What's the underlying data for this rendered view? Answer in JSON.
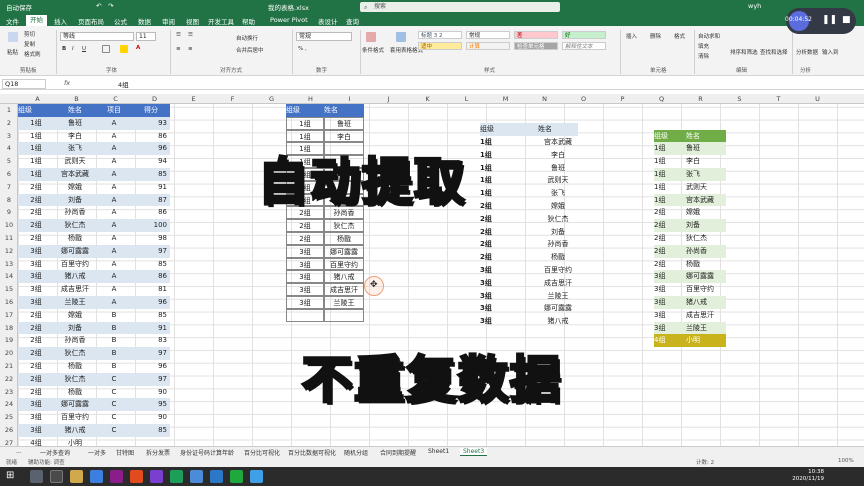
{
  "window": {
    "autosave": "自动保存",
    "filename": "我的表格.xlsx",
    "user": "wyh",
    "search_placeholder": "搜索"
  },
  "menu": [
    "文件",
    "开始",
    "插入",
    "页面布局",
    "公式",
    "数据",
    "审阅",
    "视图",
    "开发工具",
    "帮助",
    "Power Pivot",
    "表设计",
    "查询"
  ],
  "ribbon": {
    "paste": "粘贴",
    "cut": "剪切",
    "copy": "复制",
    "format_painter": "格式刷",
    "font_name": "等线",
    "font_size": "11",
    "wrap": "自动换行",
    "merge": "合并后居中",
    "num_format": "常规",
    "cond_format": "条件格式",
    "table_format": "套用表格格式",
    "styles": [
      "标题 3 2",
      "常规",
      "差",
      "好",
      "适中",
      "计算",
      "检查单元格",
      "解释性文本"
    ],
    "insert": "插入",
    "delete": "删除",
    "format": "格式",
    "sum": "自动求和",
    "fill": "填充",
    "clear": "清除",
    "sort": "排序和筛选",
    "find": "查找和选择",
    "analyze": "分析数据",
    "save_net": "输入到",
    "groups": [
      "剪贴板",
      "字体",
      "对齐方式",
      "数字",
      "样式",
      "单元格",
      "编辑",
      "分析"
    ]
  },
  "formula": {
    "namebox": "Q18",
    "value": "4组",
    "fx": "fx"
  },
  "columns": [
    "A",
    "B",
    "C",
    "D",
    "E",
    "F",
    "G",
    "H",
    "I",
    "J",
    "K",
    "L",
    "M",
    "N",
    "O",
    "P",
    "Q",
    "R",
    "S",
    "T",
    "U"
  ],
  "rows": [
    "1",
    "2",
    "3",
    "4",
    "5",
    "6",
    "7",
    "8",
    "9",
    "10",
    "11",
    "12",
    "13",
    "14",
    "15",
    "16",
    "17",
    "18",
    "19",
    "20",
    "21",
    "22",
    "23",
    "24",
    "25",
    "26",
    "27"
  ],
  "table1": {
    "headers": [
      "组级",
      "姓名",
      "项目",
      "得分"
    ],
    "rows": [
      [
        "1组",
        "鲁班",
        "A",
        "93"
      ],
      [
        "1组",
        "李白",
        "A",
        "86"
      ],
      [
        "1组",
        "张飞",
        "A",
        "96"
      ],
      [
        "1组",
        "武则天",
        "A",
        "94"
      ],
      [
        "1组",
        "宫本武藏",
        "A",
        "85"
      ],
      [
        "2组",
        "嫦娥",
        "A",
        "91"
      ],
      [
        "2组",
        "刘备",
        "A",
        "87"
      ],
      [
        "2组",
        "孙尚香",
        "A",
        "86"
      ],
      [
        "2组",
        "狄仁杰",
        "A",
        "100"
      ],
      [
        "2组",
        "杨戬",
        "A",
        "98"
      ],
      [
        "3组",
        "娜可露露",
        "A",
        "97"
      ],
      [
        "3组",
        "百里守约",
        "A",
        "85"
      ],
      [
        "3组",
        "猪八戒",
        "A",
        "86"
      ],
      [
        "3组",
        "成吉思汗",
        "A",
        "81"
      ],
      [
        "3组",
        "兰陵王",
        "A",
        "96"
      ],
      [
        "2组",
        "嫦娥",
        "B",
        "85"
      ],
      [
        "2组",
        "刘备",
        "B",
        "91"
      ],
      [
        "2组",
        "孙尚香",
        "B",
        "83"
      ],
      [
        "2组",
        "狄仁杰",
        "B",
        "97"
      ],
      [
        "2组",
        "杨戬",
        "B",
        "96"
      ],
      [
        "2组",
        "狄仁杰",
        "C",
        "97"
      ],
      [
        "2组",
        "杨戬",
        "C",
        "90"
      ],
      [
        "3组",
        "娜可露露",
        "C",
        "95"
      ],
      [
        "3组",
        "百里守约",
        "C",
        "90"
      ],
      [
        "3组",
        "猪八戒",
        "C",
        "85"
      ],
      [
        "4组",
        "小明",
        "",
        ""
      ]
    ]
  },
  "table2": {
    "headers": [
      "组级",
      "姓名"
    ],
    "rows": [
      [
        "1组",
        "鲁班"
      ],
      [
        "1组",
        "李白"
      ],
      [
        "1组",
        ""
      ],
      [
        "1组",
        ""
      ],
      [
        "1组",
        ""
      ],
      [
        "2组",
        ""
      ],
      [
        "2组",
        "刘备"
      ],
      [
        "2组",
        "孙尚香"
      ],
      [
        "2组",
        "狄仁杰"
      ],
      [
        "2组",
        "杨戬"
      ],
      [
        "3组",
        "娜可露露"
      ],
      [
        "3组",
        "百里守约"
      ],
      [
        "3组",
        "猪八戒"
      ],
      [
        "3组",
        "成吉思汗"
      ],
      [
        "3组",
        "兰陵王"
      ]
    ]
  },
  "pivot": {
    "headers": [
      "组级",
      "姓名"
    ],
    "rows": [
      [
        "1组",
        "宫本武藏"
      ],
      [
        "1组",
        "李白"
      ],
      [
        "1组",
        "鲁班"
      ],
      [
        "1组",
        "武则天"
      ],
      [
        "1组",
        "张飞"
      ],
      [
        "2组",
        "嫦娥"
      ],
      [
        "2组",
        "狄仁杰"
      ],
      [
        "2组",
        "刘备"
      ],
      [
        "2组",
        "孙尚香"
      ],
      [
        "2组",
        "杨戬"
      ],
      [
        "3组",
        "百里守约"
      ],
      [
        "3组",
        "成吉思汗"
      ],
      [
        "3组",
        "兰陵王"
      ],
      [
        "3组",
        "娜可露露"
      ],
      [
        "3组",
        "猪八戒"
      ]
    ]
  },
  "table4": {
    "headers": [
      "组级",
      "姓名"
    ],
    "rows": [
      [
        "1组",
        "鲁班"
      ],
      [
        "1组",
        "李白"
      ],
      [
        "1组",
        "张飞"
      ],
      [
        "1组",
        "武则天"
      ],
      [
        "1组",
        "宫本武藏"
      ],
      [
        "2组",
        "嫦娥"
      ],
      [
        "2组",
        "刘备"
      ],
      [
        "2组",
        "狄仁杰"
      ],
      [
        "2组",
        "孙尚香"
      ],
      [
        "2组",
        "杨戬"
      ],
      [
        "3组",
        "娜可露露"
      ],
      [
        "3组",
        "百里守约"
      ],
      [
        "3组",
        "猪八戒"
      ],
      [
        "3组",
        "成吉思汗"
      ],
      [
        "3组",
        "兰陵王"
      ],
      [
        "4组",
        "小明"
      ]
    ]
  },
  "overlay": {
    "top": "自动提取",
    "bottom": "不重复数据"
  },
  "sheets": [
    "...",
    "一对多查询",
    "一对多",
    "甘特图",
    "拆分发票",
    "身份证号码计算年龄",
    "百分比可视化",
    "百分比数据可视化",
    "随机分组",
    "合同到期提醒",
    "Sheet1",
    "Sheet3"
  ],
  "status": {
    "ready": "就绪",
    "accessibility": "辅助功能: 调查",
    "count": "计数: 2",
    "zoom": "100%"
  },
  "clock": {
    "time": "10:38",
    "date": "2020/11/19"
  },
  "recorder": {
    "time": "00:04:52"
  },
  "colors": {
    "excel_green": "#217346",
    "table_blue": "#4472c4",
    "table_green": "#70ad47",
    "highlight": "#c9b31d"
  }
}
